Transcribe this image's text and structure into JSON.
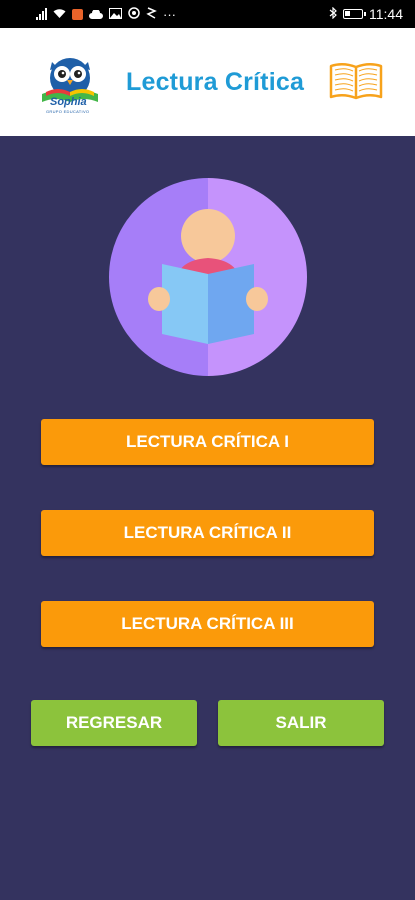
{
  "status_bar": {
    "time": "11:44",
    "more": "···",
    "battery_level": "10"
  },
  "header": {
    "title": "Lectura Crítica",
    "logo_text": "Sophia",
    "logo_subtext": "GRUPO EDUCATIVO"
  },
  "menu": {
    "items": [
      {
        "label": "LECTURA CRÍTICA I"
      },
      {
        "label": "LECTURA CRÍTICA II"
      },
      {
        "label": "LECTURA CRÍTICA III"
      }
    ]
  },
  "footer": {
    "back_label": "REGRESAR",
    "exit_label": "SALIR"
  },
  "colors": {
    "background": "#34335f",
    "accent_orange": "#fb9a0a",
    "accent_green": "#8cc33c",
    "title_blue": "#1f9bd6",
    "book_orange": "#f7a21b"
  }
}
